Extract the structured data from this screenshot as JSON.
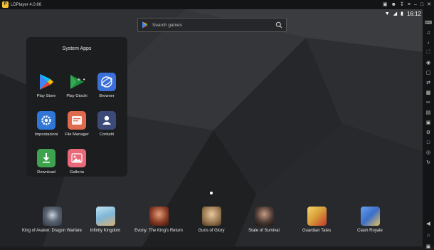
{
  "window": {
    "title": "LDPlayer 4.0.66",
    "logo_text": "P"
  },
  "titlebar_icons": [
    "gamepad-icon",
    "user-icon",
    "download-icon",
    "menu-icon",
    "minimize-icon",
    "maximize-icon",
    "close-icon"
  ],
  "status": {
    "time": "16:12"
  },
  "search": {
    "placeholder": "Search games"
  },
  "folder": {
    "title": "System Apps",
    "apps": [
      {
        "label": "Play Store",
        "icon": "play-store-icon",
        "color": "#ffffff"
      },
      {
        "label": "Play Giochi",
        "icon": "play-games-icon",
        "color": "#1e8e3e"
      },
      {
        "label": "Browser",
        "icon": "browser-icon",
        "color": "#3b6fd9"
      },
      {
        "label": "Impostazioni",
        "icon": "settings-icon",
        "color": "#2f76d6"
      },
      {
        "label": "File Manager",
        "icon": "file-manager-icon",
        "color": "#e06a4e"
      },
      {
        "label": "Contatti",
        "icon": "contacts-icon",
        "color": "#3c4a78"
      },
      {
        "label": "Download",
        "icon": "download-app-icon",
        "color": "#3ea34f"
      },
      {
        "label": "Galleria",
        "icon": "gallery-icon",
        "color": "#e86a7a"
      }
    ]
  },
  "dock": {
    "games": [
      {
        "label": "King of Avalon: Dragon Warfare",
        "icon": "king-of-avalon-icon",
        "color": "#4a5563"
      },
      {
        "label": "Infinity Kingdom",
        "icon": "infinity-kingdom-icon",
        "color": "#7fb6d6"
      },
      {
        "label": "Evony: The King's Return",
        "icon": "evony-icon",
        "color": "#8a3b25"
      },
      {
        "label": "Guns of Glory",
        "icon": "guns-of-glory-icon",
        "color": "#9b7a52"
      },
      {
        "label": "State of Survival",
        "icon": "state-of-survival-icon",
        "color": "#4b3a34"
      },
      {
        "label": "Guardian Tales",
        "icon": "guardian-tales-icon",
        "color": "#d9a23b"
      },
      {
        "label": "Clash Royale",
        "icon": "clash-royale-icon",
        "color": "#3b6fc9"
      }
    ]
  },
  "sidebar_tools": [
    "keyboard-icon",
    "volume-up-icon",
    "volume-down-icon",
    "fullscreen-icon",
    "record-icon",
    "screenshot-icon",
    "sync-icon",
    "apk-icon",
    "scissors-icon",
    "operation-record-icon",
    "virtual-position-icon",
    "more-settings-icon",
    "folder-icon",
    "location-icon",
    "rotate-icon"
  ],
  "nav_buttons": [
    "back-icon",
    "home-icon",
    "recent-apps-icon"
  ]
}
